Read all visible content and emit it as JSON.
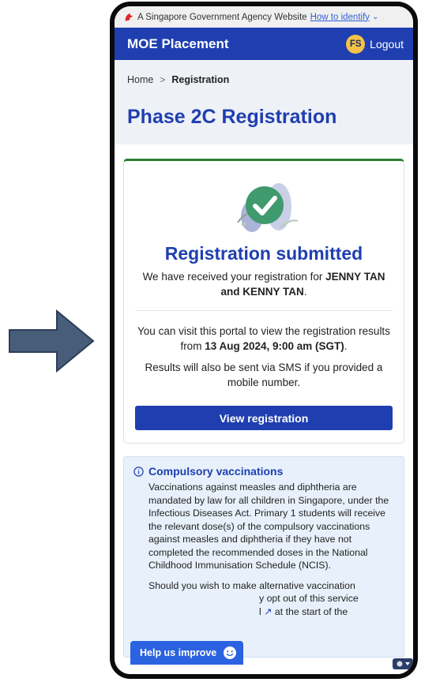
{
  "gov_banner": {
    "text": "A Singapore Government Agency Website",
    "link": "How to identify",
    "icon": "lion-head-icon"
  },
  "header": {
    "title": "MOE Placement",
    "avatar_initials": "FS",
    "logout_label": "Logout"
  },
  "breadcrumb": {
    "home": "Home",
    "separator": ">",
    "current": "Registration"
  },
  "page_title": "Phase 2C Registration",
  "card": {
    "title": "Registration submitted",
    "received_prefix": "We have received your registration for ",
    "received_names": "JENNY TAN and KENNY TAN",
    "received_suffix": ".",
    "visit_prefix": "You can visit this portal to view the registration results from ",
    "visit_date": "13 Aug 2024, 9:00 am (SGT)",
    "visit_suffix": ".",
    "sms_text": "Results will also be sent via SMS if you provided a mobile number.",
    "button_label": "View registration"
  },
  "vaccination": {
    "title": "Compulsory vaccinations",
    "para1": "Vaccinations against measles and diphtheria are mandated by law for all children in Singapore, under the Infectious Diseases Act. Primary 1 students will receive the relevant dose(s) of the compulsory vaccinations against measles and diphtheria if they have not completed the recommended doses in the National Childhood Immunisation Schedule (NCIS).",
    "para2_line1": "Should you wish to make alternative vaccination",
    "para2_line2": "y opt out of this service",
    "para2_line3_suffix": "at the start of the"
  },
  "floating": {
    "help_label": "Help us improve"
  },
  "colors": {
    "primary": "#1f3fb0",
    "success": "#2e7d32",
    "info_bg": "#e8f1fb",
    "accent_yellow": "#f4c24a"
  }
}
